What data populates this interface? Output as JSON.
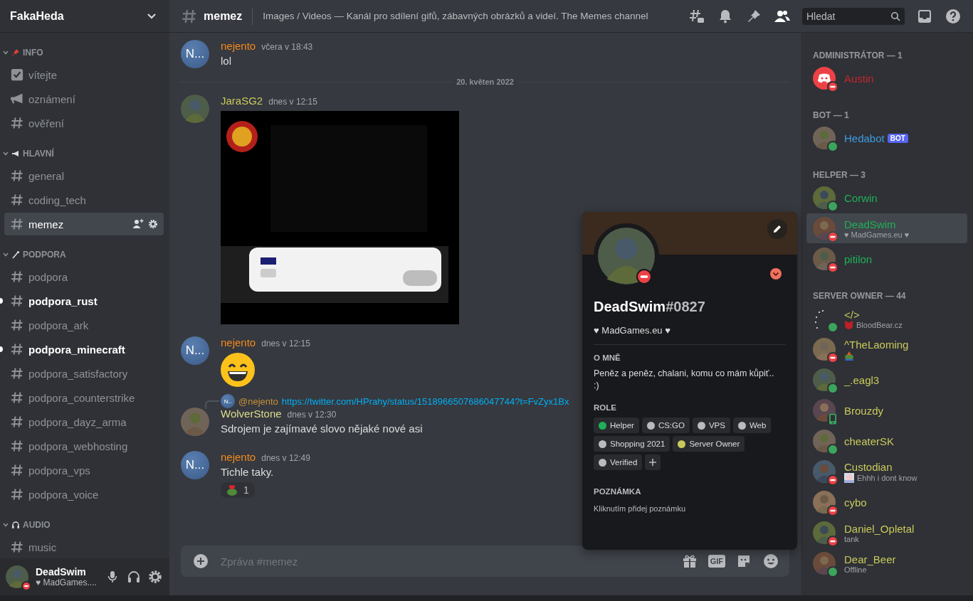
{
  "server": {
    "name": "FakaHeda"
  },
  "categories": [
    {
      "name": "INFO",
      "expanded": true,
      "channels": [
        {
          "name": "vítejte",
          "kind": "rules",
          "unread": false,
          "selected": false
        },
        {
          "name": "oznámení",
          "kind": "announcement",
          "unread": false,
          "selected": false
        },
        {
          "name": "ověření",
          "kind": "text",
          "unread": false,
          "selected": false
        }
      ]
    },
    {
      "name": "HLAVNÍ",
      "expanded": true,
      "channels": [
        {
          "name": "general",
          "kind": "text",
          "unread": false,
          "selected": false
        },
        {
          "name": "coding_tech",
          "kind": "text",
          "unread": false,
          "selected": false
        },
        {
          "name": "memez",
          "kind": "text",
          "unread": false,
          "selected": true
        }
      ]
    },
    {
      "name": "PODPORA",
      "expanded": true,
      "channels": [
        {
          "name": "podpora",
          "kind": "text",
          "unread": false,
          "selected": false
        },
        {
          "name": "podpora_rust",
          "kind": "text",
          "unread": true,
          "selected": false
        },
        {
          "name": "podpora_ark",
          "kind": "text",
          "unread": false,
          "selected": false
        },
        {
          "name": "podpora_minecraft",
          "kind": "text",
          "unread": true,
          "selected": false
        },
        {
          "name": "podpora_satisfactory",
          "kind": "text",
          "unread": false,
          "selected": false
        },
        {
          "name": "podpora_counterstrike",
          "kind": "text",
          "unread": false,
          "selected": false
        },
        {
          "name": "podpora_dayz_arma",
          "kind": "text",
          "unread": false,
          "selected": false
        },
        {
          "name": "podpora_webhosting",
          "kind": "text",
          "unread": false,
          "selected": false
        },
        {
          "name": "podpora_vps",
          "kind": "text",
          "unread": false,
          "selected": false
        },
        {
          "name": "podpora_voice",
          "kind": "text",
          "unread": false,
          "selected": false
        }
      ]
    },
    {
      "name": "AUDIO",
      "expanded": true,
      "channels": [
        {
          "name": "music",
          "kind": "text",
          "unread": false,
          "selected": false
        }
      ]
    }
  ],
  "user": {
    "name": "DeadSwim",
    "status_text": "♥ MadGames....",
    "do_not_disturb": true
  },
  "header": {
    "channel": "memez",
    "topic": "Images / Videos — Kanál pro sdílení gifů, zábavných obrázků a videí. The Memes channel",
    "search": {
      "placeholder": "Hledat"
    }
  },
  "messages": [
    {
      "kind": "text",
      "author": "nejento",
      "color": "#f48a1d",
      "time": "včera v 18:43",
      "avatar_text": "N...",
      "text": "lol"
    },
    {
      "kind": "divider",
      "text": "20. květen 2022"
    },
    {
      "author": "JaraSG2",
      "color": "#c9c95b",
      "time": "dnes v 12:15"
    },
    {
      "kind": "emoji",
      "author": "nejento",
      "color": "#f48a1d",
      "time": "dnes v 12:15",
      "avatar_text": "N..."
    },
    {
      "kind": "text",
      "author": "WolverStone",
      "color": "#dcdc8c",
      "time": "dnes v 12:30",
      "reply": {
        "avatar_text": "N...",
        "author": "@nejento",
        "text": "https://twitter.com/HPrahy/status/1518966507686047744?t=FvZyx1Bx"
      },
      "text": "Sdrojem je zajímavé slovo nějaké nové asi"
    },
    {
      "kind": "text",
      "author": "nejento",
      "color": "#f48a1d",
      "time": "dnes v 12:49",
      "avatar_text": "N...",
      "text": "Tichle taky.",
      "reactions": [
        {
          "count": "1"
        }
      ]
    }
  ],
  "composer": {
    "placeholder": "Zpráva #memez",
    "gif_label": "GIF"
  },
  "members": [
    {
      "title": "ADMINISTRÁTOR — 1",
      "members": [
        {
          "name": "Austin",
          "color": "#c4262b",
          "do_not_disturb": true,
          "mobile": false,
          "selected": false
        }
      ]
    },
    {
      "title": "BOT — 1",
      "members": [
        {
          "name": "Hedabot",
          "color": "#3d9ae0",
          "do_not_disturb": false,
          "mobile": false,
          "bot": "BOT",
          "selected": false
        }
      ]
    },
    {
      "title": "HELPER — 3",
      "members": [
        {
          "name": "Corwin",
          "color": "#1fb157",
          "do_not_disturb": false,
          "mobile": false,
          "selected": false
        },
        {
          "name": "DeadSwim",
          "color": "#1fb157",
          "do_not_disturb": true,
          "mobile": false,
          "activity": "♥ MadGames.eu ♥",
          "selected": true
        },
        {
          "name": "pitilon",
          "color": "#1fb157",
          "do_not_disturb": true,
          "mobile": false,
          "selected": false
        }
      ]
    },
    {
      "title": "SERVER OWNER — 44",
      "members": [
        {
          "name": "</>",
          "color": "#c9c95b",
          "do_not_disturb": false,
          "mobile": false,
          "activity": "BloodBear.cz",
          "selected": false
        },
        {
          "name": "^TheLaoming",
          "color": "#c9c95b",
          "do_not_disturb": true,
          "mobile": false,
          "selected": false
        },
        {
          "name": "_.eagl3",
          "color": "#c9c95b",
          "do_not_disturb": false,
          "mobile": false,
          "selected": false
        },
        {
          "name": "Brouzdy",
          "color": "#c9c95b",
          "do_not_disturb": false,
          "mobile": true,
          "selected": false
        },
        {
          "name": "cheaterSK",
          "color": "#c9c95b",
          "do_not_disturb": false,
          "mobile": false,
          "selected": false
        },
        {
          "name": "Custodian",
          "color": "#c9c95b",
          "do_not_disturb": true,
          "mobile": false,
          "activity": "Ehhh i dont know",
          "selected": false
        },
        {
          "name": "cybo",
          "color": "#c9c95b",
          "do_not_disturb": true,
          "mobile": false,
          "selected": false
        },
        {
          "name": "Daniel_Opletal",
          "color": "#c9c95b",
          "do_not_disturb": true,
          "mobile": false,
          "activity": "tank",
          "selected": false
        },
        {
          "name": "Dear_Beer",
          "color": "#c9c95b",
          "do_not_disturb": false,
          "mobile": false,
          "activity": "Offline",
          "selected": false
        }
      ]
    }
  ],
  "profile": {
    "name": "DeadSwim",
    "tag": "#0827",
    "do_not_disturb": true,
    "custom_status": "♥ MadGames.eu ♥",
    "about_heading": "O MNĚ",
    "about": "Peněz a peněz, chalani, komu co mám kůpiť.. :)",
    "roles_heading": "ROLE",
    "roles": [
      {
        "name": "Helper",
        "color": "#1fb157"
      },
      {
        "name": "CS:GO",
        "color": "#b9bbbe"
      },
      {
        "name": "VPS",
        "color": "#b9bbbe"
      },
      {
        "name": "Web",
        "color": "#b9bbbe"
      },
      {
        "name": "Shopping 2021",
        "color": "#b9bbbe"
      },
      {
        "name": "Server Owner",
        "color": "#c9c95b"
      },
      {
        "name": "Verified",
        "color": "#b9bbbe"
      }
    ],
    "note_heading": "POZNÁMKA",
    "note": {
      "placeholder": "Kliknutím přidej poznámku"
    }
  }
}
